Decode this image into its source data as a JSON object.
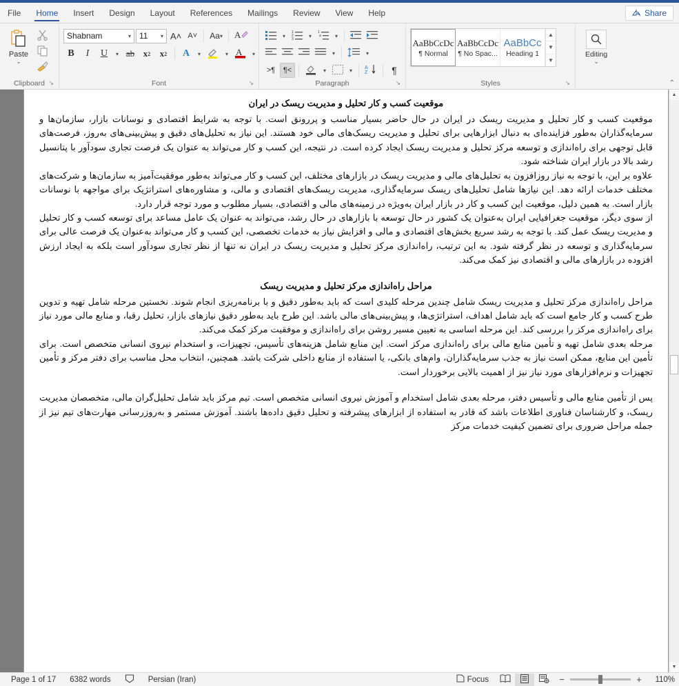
{
  "app": {
    "accent_color": "#2b579a",
    "ribbon_bg": "#f3f3f3"
  },
  "tabs": [
    {
      "label": "File",
      "active": false
    },
    {
      "label": "Home",
      "active": true
    },
    {
      "label": "Insert",
      "active": false
    },
    {
      "label": "Design",
      "active": false
    },
    {
      "label": "Layout",
      "active": false
    },
    {
      "label": "References",
      "active": false
    },
    {
      "label": "Mailings",
      "active": false
    },
    {
      "label": "Review",
      "active": false
    },
    {
      "label": "View",
      "active": false
    },
    {
      "label": "Help",
      "active": false
    }
  ],
  "share": {
    "label": "Share",
    "icon": "share-person-icon"
  },
  "ribbon": {
    "clipboard": {
      "group_label": "Clipboard",
      "paste_label": "Paste",
      "cut_icon": "scissors-icon",
      "copy_icon": "copy-icon",
      "format_painter_icon": "paintbrush-icon",
      "dialog_launcher": "↘"
    },
    "font": {
      "group_label": "Font",
      "font_name": "Shabnam",
      "font_size": "11",
      "grow_font": "A˄",
      "shrink_font": "A˅",
      "change_case": "Aa",
      "clear_formatting": "clear-formatting-icon",
      "bold": "B",
      "italic": "I",
      "underline": "U",
      "strikethrough": "ab",
      "subscript": "x",
      "superscript": "x",
      "text_effects": "A",
      "highlight": "highlight-icon",
      "font_color": "A",
      "dialog_launcher": "↘"
    },
    "paragraph": {
      "group_label": "Paragraph",
      "bullets": "bullet-list-icon",
      "numbering": "numbered-list-icon",
      "multilevel": "multilevel-list-icon",
      "decrease_indent": "decrease-indent-icon",
      "increase_indent": "increase-indent-icon",
      "align_left": "align-left-icon",
      "align_center": "align-center-icon",
      "align_right": "align-right-icon",
      "justify": "justify-icon",
      "line_spacing": "line-spacing-icon",
      "ltr_text": ">¶",
      "rtl_text": "¶<",
      "rtl_active": true,
      "shading": "shading-icon",
      "borders": "borders-icon",
      "sort": "sort-az-icon",
      "show_marks": "¶",
      "dialog_launcher": "↘"
    },
    "styles": {
      "group_label": "Styles",
      "items": [
        {
          "preview": "AaBbCcDc",
          "name": "¶ Normal",
          "selected": true
        },
        {
          "preview": "AaBbCcDc",
          "name": "¶ No Spac...",
          "selected": false
        },
        {
          "preview": "AaBbCс",
          "name": "Heading 1",
          "selected": false
        }
      ],
      "dialog_launcher": "↘"
    },
    "editing": {
      "group_label": "Editing",
      "icon": "search-icon",
      "chevron": "⌄"
    },
    "collapse_ribbon": "⌃"
  },
  "document": {
    "heading1": "موقعیت کسب و کار تحلیل و مدیریت ریسک در ایران",
    "para1": "موقعیت کسب و کار تحلیل و مدیریت ریسک در ایران در حال حاضر بسیار مناسب و پررونق است. با توجه به شرایط اقتصادی و نوسانات بازار، سازمان‌ها و سرمایه‌گذاران به‌طور فزاینده‌ای به دنبال ابزارهایی برای تحلیل و مدیریت ریسک‌های مالی خود هستند. این نیاز به تحلیل‌های دقیق و پیش‌بینی‌های به‌روز، فرصت‌های قابل توجهی برای راه‌اندازی و توسعه مرکز تحلیل و مدیریت ریسک ایجاد کرده است. در نتیجه، این کسب و کار می‌تواند به عنوان یک فرصت تجاری سودآور با پتانسیل رشد بالا در بازار ایران شناخته شود.",
    "para2": "علاوه بر این، با توجه به نیاز روزافزون به تحلیل‌های مالی و مدیریت ریسک در بازارهای مختلف، این کسب و کار می‌تواند به‌طور موفقیت‌آمیز به سازمان‌ها و شرکت‌های مختلف خدمات ارائه دهد. این نیازها شامل تحلیل‌های ریسک سرمایه‌گذاری، مدیریت ریسک‌های اقتصادی و مالی، و مشاوره‌های استراتژیک برای مواجهه با نوسانات بازار است. به همین دلیل، موقعیت این کسب و کار در بازار ایران به‌ویژه در زمینه‌های مالی و اقتصادی، بسیار مطلوب و مورد توجه قرار دارد.",
    "para3": "از سوی دیگر، موقعیت جغرافیایی ایران به‌عنوان یک کشور در حال توسعه با بازارهای در حال رشد، می‌تواند به عنوان یک عامل مساعد برای توسعه کسب و کار تحلیل و مدیریت ریسک عمل کند. با توجه به رشد سریع بخش‌های اقتصادی و مالی و افزایش نیاز به خدمات تخصصی، این کسب و کار می‌تواند به‌عنوان یک فرصت عالی برای سرمایه‌گذاری و توسعه در نظر گرفته شود. به این ترتیب، راه‌اندازی مرکز تحلیل و مدیریت ریسک در ایران نه تنها از نظر تجاری سودآور است بلکه به ایجاد ارزش افزوده در بازارهای مالی و اقتصادی نیز کمک می‌کند.",
    "heading2": "مراحل راه‌اندازی مرکز تحلیل و مدیریت ریسک",
    "para4": "مراحل راه‌اندازی مرکز تحلیل و مدیریت ریسک شامل چندین مرحله کلیدی است که باید به‌طور دقیق و با برنامه‌ریزی انجام شوند. نخستین مرحله شامل تهیه و تدوین طرح کسب و کار جامع است که باید شامل اهداف، استراتژی‌ها، و پیش‌بینی‌های مالی باشد. این طرح باید به‌طور دقیق نیازهای بازار، تحلیل رقبا، و منابع مالی مورد نیاز برای راه‌اندازی مرکز را بررسی کند. این مرحله اساسی به تعیین مسیر روشن برای راه‌اندازی و موفقیت مرکز کمک می‌کند.",
    "para5": "مرحله بعدی شامل تهیه و تأمین منابع مالی برای راه‌اندازی مرکز است. این منابع شامل هزینه‌های تأسیس، تجهیزات، و استخدام نیروی انسانی متخصص است. برای تأمین این منابع، ممکن است نیاز به جذب سرمایه‌گذاران، وام‌های بانکی، یا استفاده از منابع داخلی شرکت باشد. همچنین، انتخاب محل مناسب برای دفتر مرکز و تأمین تجهیزات و نرم‌افزارهای مورد نیاز نیز از اهمیت بالایی برخوردار است.",
    "para6": "پس از تأمین منابع مالی و تأسیس دفتر، مرحله بعدی شامل استخدام و آموزش نیروی انسانی متخصص است. تیم مرکز باید شامل تحلیل‌گران مالی، متخصصان مدیریت ریسک، و کارشناسان فناوری اطلاعات باشد که قادر به استفاده از ابزارهای پیشرفته و تحلیل دقیق داده‌ها باشند. آموزش مستمر و به‌روزرسانی مهارت‌های تیم نیز از جمله مراحل ضروری برای تضمین کیفیت خدمات مرکز"
  },
  "statusbar": {
    "page": "Page 1 of 17",
    "words": "6382 words",
    "proofing_icon": "proofing-errors-icon",
    "language": "Persian (Iran)",
    "focus": "Focus",
    "focus_icon": "focus-icon",
    "read_mode_icon": "read-mode-icon",
    "print_layout_icon": "print-layout-icon",
    "web_layout_icon": "web-layout-icon",
    "zoom_out": "−",
    "zoom_in": "+",
    "zoom_level": "110%"
  }
}
